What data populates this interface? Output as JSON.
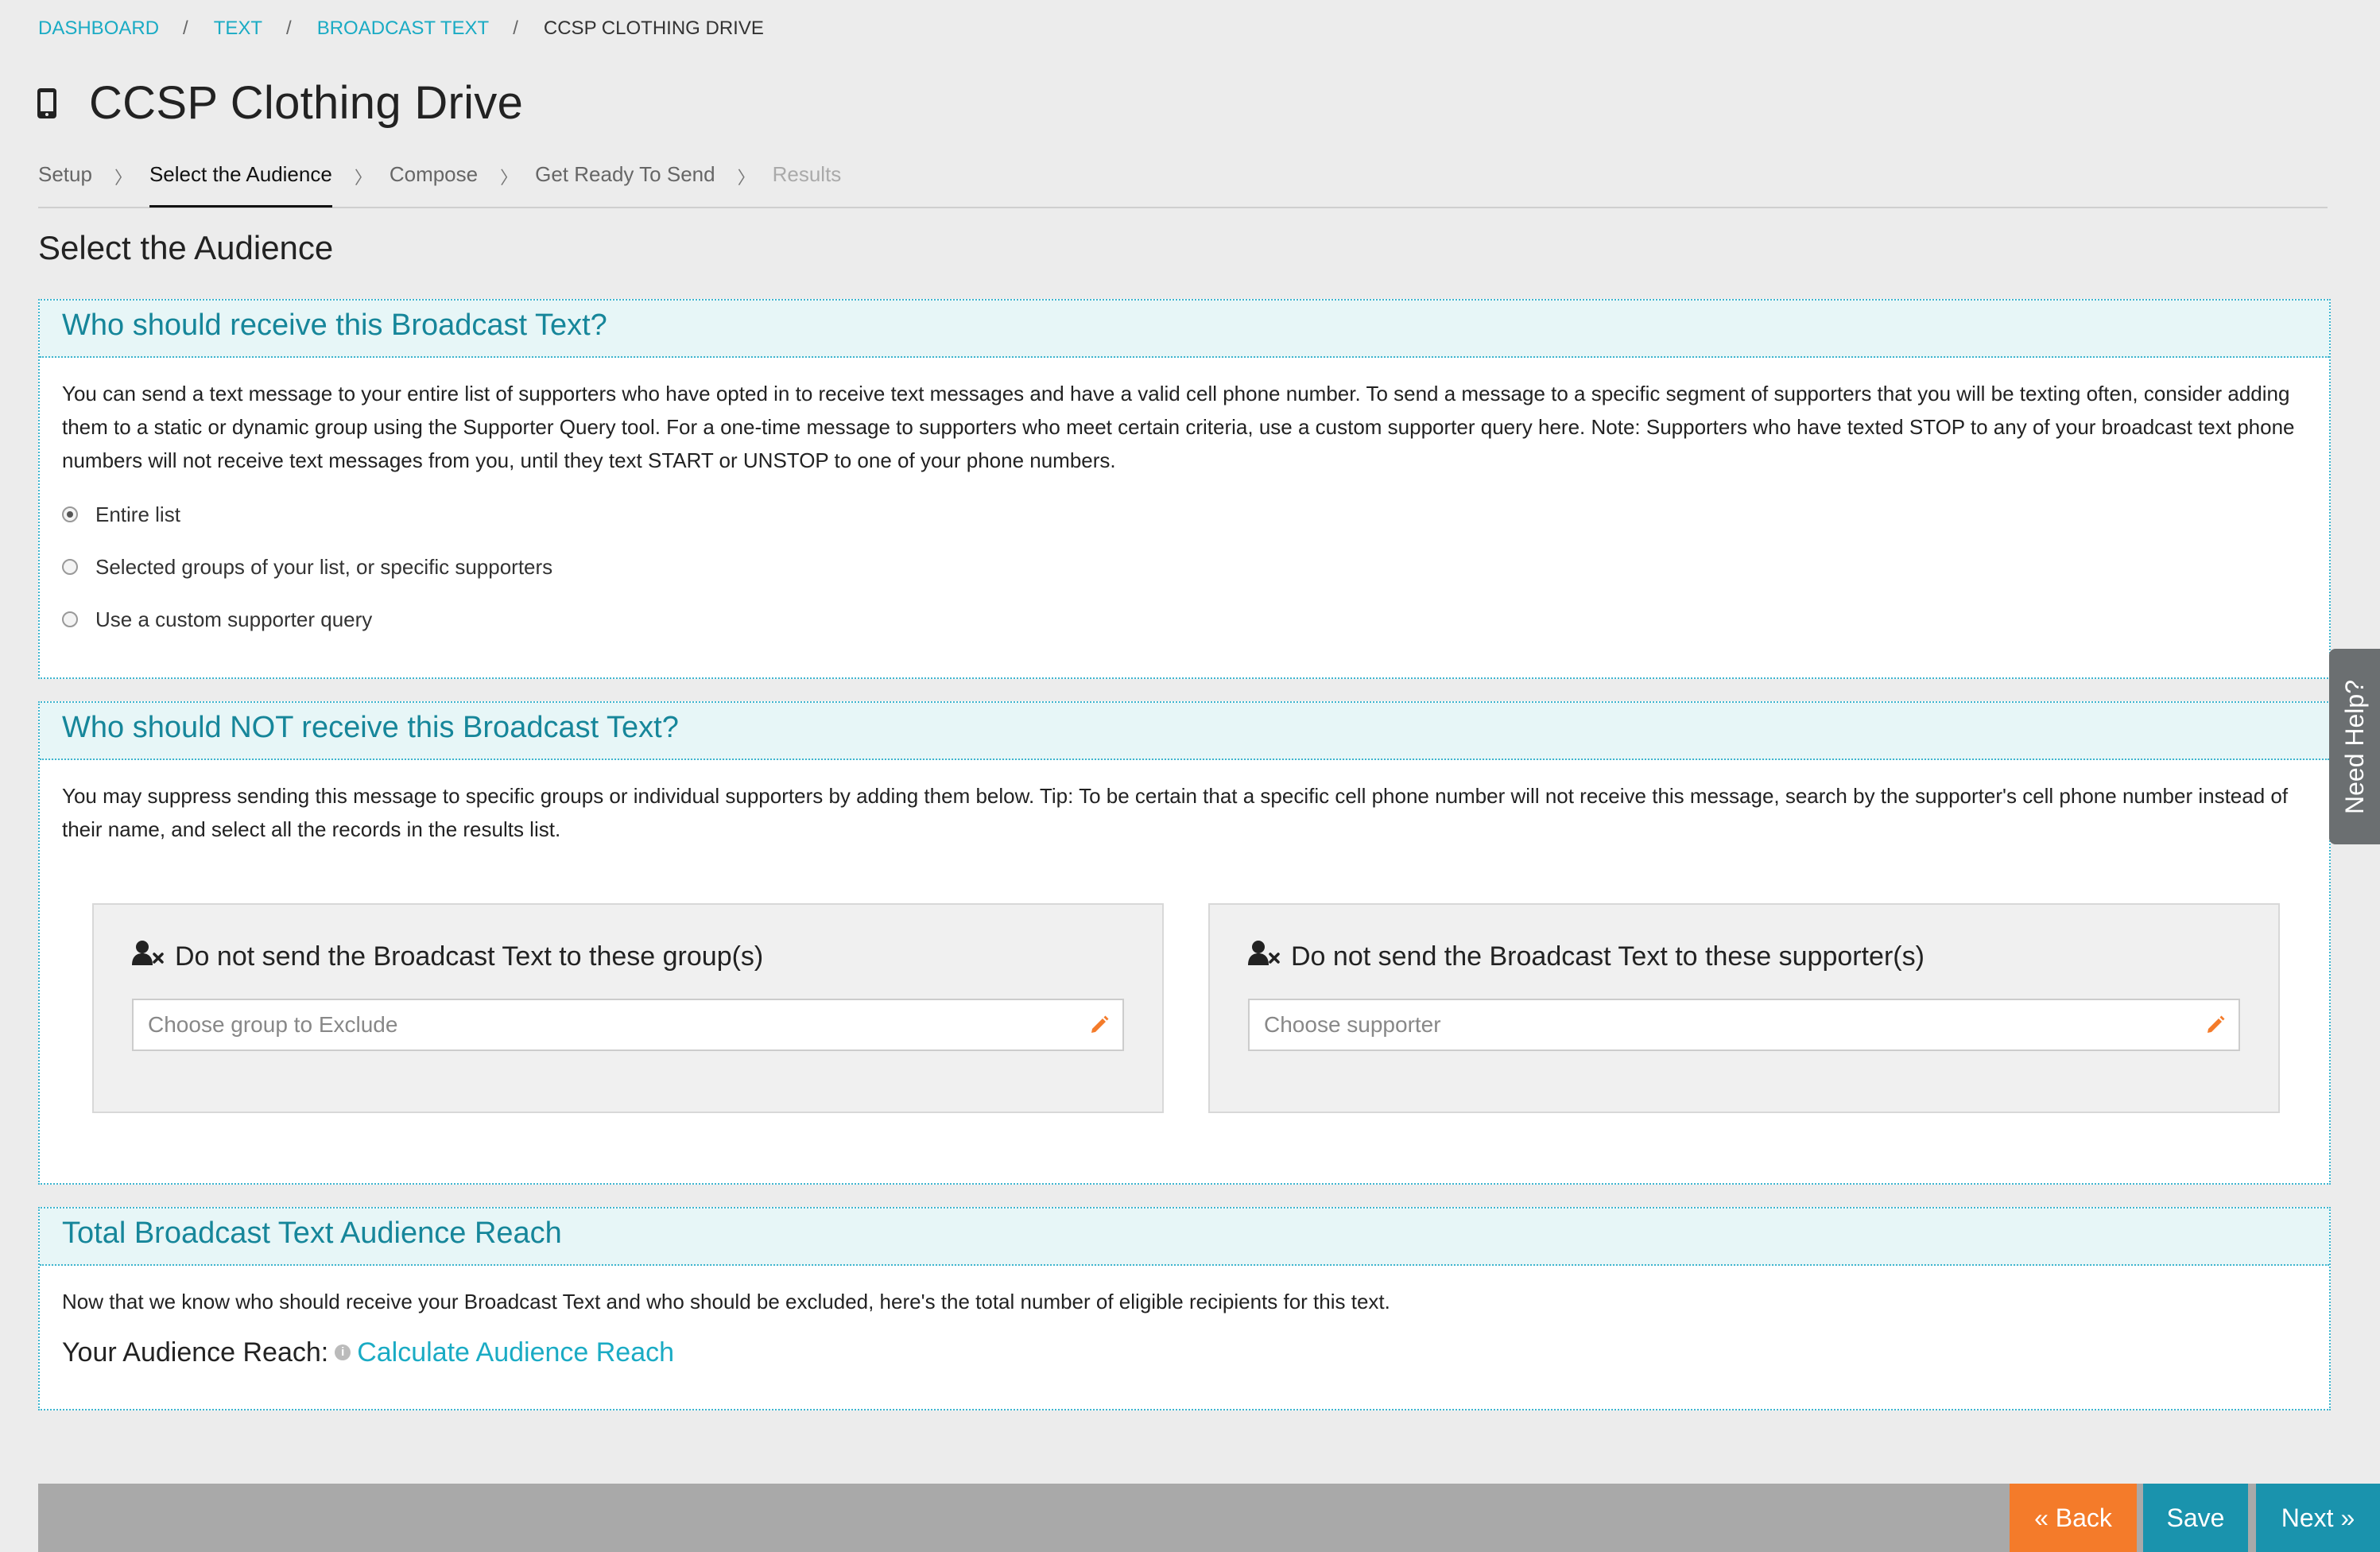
{
  "breadcrumb": {
    "items": [
      "DASHBOARD",
      "TEXT",
      "BROADCAST TEXT"
    ],
    "current": "CCSP CLOTHING DRIVE",
    "separator": "/"
  },
  "title": "CCSP Clothing Drive",
  "steps": {
    "items": [
      "Setup",
      "Select the Audience",
      "Compose",
      "Get Ready To Send",
      "Results"
    ],
    "active": "Select the Audience",
    "chevron": "〉"
  },
  "section_heading": "Select the Audience",
  "receive_panel": {
    "heading": "Who should receive this Broadcast Text?",
    "description": "You can send a text message to your entire list of supporters who have opted in to receive text messages and have a valid cell phone number. To send a message to a specific segment of supporters that you will be texting often, consider adding them to a static or dynamic group using the Supporter Query tool. For a one-time message to supporters who meet certain criteria, use a custom supporter query here. Note: Supporters who have texted STOP to any of your broadcast text phone numbers will not receive text messages from you, until they text START or UNSTOP to one of your phone numbers.",
    "options": [
      "Entire list",
      "Selected groups of your list, or specific supporters",
      "Use a custom supporter query"
    ],
    "selected": "Entire list"
  },
  "exclude_panel": {
    "heading": "Who should NOT receive this Broadcast Text?",
    "description": "You may suppress sending this message to specific groups or individual supporters by adding them below. Tip: To be certain that a specific cell phone number will not receive this message, search by the supporter's cell phone number instead of their name, and select all the records in the results list.",
    "groups": {
      "title": "Do not send the Broadcast Text to these group(s)",
      "placeholder": "Choose group to Exclude"
    },
    "supporters": {
      "title": "Do not send the Broadcast Text to these supporter(s)",
      "placeholder": "Choose supporter"
    }
  },
  "reach_panel": {
    "heading": "Total Broadcast Text Audience Reach",
    "description": "Now that we know who should receive your Broadcast Text and who should be excluded, here's the total number of eligible recipients for this text.",
    "label": "Your Audience Reach:",
    "info_glyph": "i",
    "link": "Calculate Audience Reach"
  },
  "need_help": "Need Help?",
  "footer": {
    "back": "« Back",
    "save": "Save",
    "next": "Next »"
  },
  "colors": {
    "accent": "#1aabc4",
    "panel_heading": "#16869a",
    "back_button": "#f47b2a",
    "primary_button": "#1a93ad",
    "pencil": "#f47b2a"
  },
  "icons": [
    "mobile-phone-icon",
    "user-remove-icon",
    "pencil-icon",
    "info-icon"
  ]
}
